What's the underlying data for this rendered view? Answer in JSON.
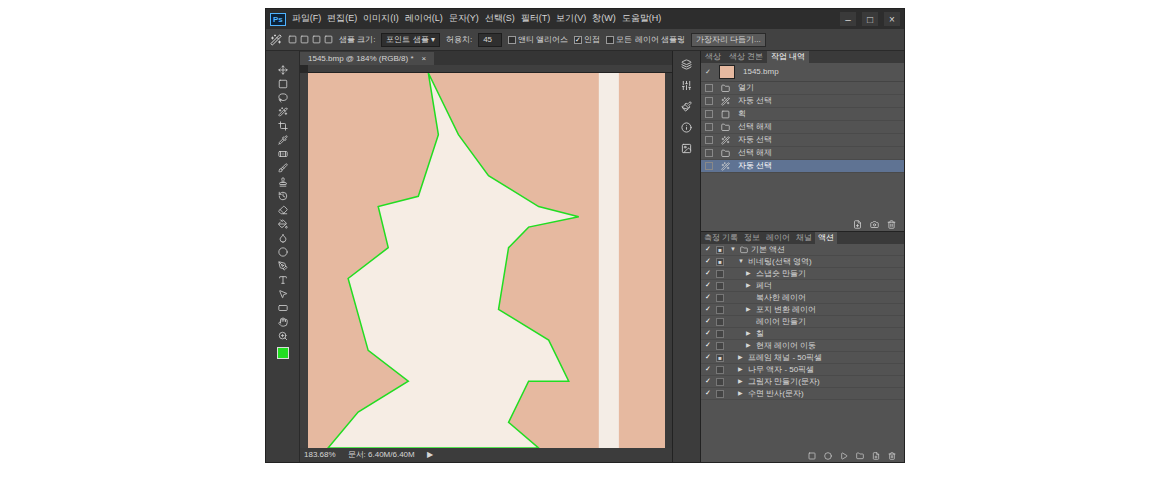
{
  "app": {
    "logo": "Ps",
    "menus": [
      "파일(F)",
      "편집(E)",
      "이미지(I)",
      "레이어(L)",
      "문자(Y)",
      "선택(S)",
      "필터(T)",
      "보기(V)",
      "창(W)",
      "도움말(H)"
    ],
    "window_controls": [
      "–",
      "□",
      "×"
    ]
  },
  "options_bar": {
    "sample_size_label": "샘플 크기:",
    "sample_size_value": "포인트 샘플",
    "tolerance_label": "허용치:",
    "tolerance_value": "45",
    "checks": [
      {
        "label": "앤티 앨리어스",
        "checked": false
      },
      {
        "label": "인접",
        "checked": true
      },
      {
        "label": "모든 레이어 샘플링",
        "checked": false
      }
    ],
    "button": "가장자리 다듬기..."
  },
  "document_tab": {
    "label": "1545.bmp @ 184% (RGB/8) *",
    "close": "×"
  },
  "toolbar": {
    "foreground_color": "#22dd22"
  },
  "status_bar": {
    "zoom": "183.68%",
    "doc": "문서: 6.40M/6.40M",
    "arrow": "▶"
  },
  "history_panel": {
    "tabs": [
      {
        "label": "색상",
        "selected": false
      },
      {
        "label": "색상 견본",
        "selected": false
      },
      {
        "label": "작업 내역",
        "selected": true
      }
    ],
    "snapshot": "1545.bmp",
    "items": [
      {
        "label": "열기",
        "kind": "open",
        "selected": false
      },
      {
        "label": "자동 선택",
        "kind": "wand",
        "selected": false
      },
      {
        "label": "획",
        "kind": "stroke",
        "selected": false
      },
      {
        "label": "선택 해제",
        "kind": "deselect",
        "selected": false
      },
      {
        "label": "자동 선택",
        "kind": "wand",
        "selected": false
      },
      {
        "label": "선택 해제",
        "kind": "deselect",
        "selected": false
      },
      {
        "label": "자동 선택",
        "kind": "wand",
        "selected": true
      }
    ]
  },
  "actions_panel": {
    "tabs": [
      {
        "label": "측정 기록",
        "selected": false
      },
      {
        "label": "정보",
        "selected": false
      },
      {
        "label": "레이어",
        "selected": false
      },
      {
        "label": "채널",
        "selected": false
      },
      {
        "label": "액션",
        "selected": true
      }
    ],
    "items": [
      {
        "label": "기본 액션",
        "depth": 0,
        "kind": "set",
        "expandable": true,
        "expanded": true,
        "checked": true,
        "dialog": true
      },
      {
        "label": "비네팅(선택 영역)",
        "depth": 1,
        "kind": "action",
        "expandable": true,
        "expanded": true,
        "checked": true,
        "dialog": true
      },
      {
        "label": "스냅숏 만들기",
        "depth": 2,
        "kind": "step",
        "expandable": true,
        "expanded": false,
        "checked": true,
        "dialog": false
      },
      {
        "label": "페더",
        "depth": 2,
        "kind": "step",
        "expandable": true,
        "expanded": false,
        "checked": true,
        "dialog": false
      },
      {
        "label": "복사한 레이어",
        "depth": 2,
        "kind": "step",
        "expandable": false,
        "expanded": false,
        "checked": true,
        "dialog": false
      },
      {
        "label": "포지 변환 레이어",
        "depth": 2,
        "kind": "step",
        "expandable": true,
        "expanded": false,
        "checked": true,
        "dialog": false
      },
      {
        "label": "레이어 만들기",
        "depth": 2,
        "kind": "step",
        "expandable": false,
        "expanded": false,
        "checked": true,
        "dialog": false
      },
      {
        "label": "칠",
        "depth": 2,
        "kind": "step",
        "expandable": true,
        "expanded": false,
        "checked": true,
        "dialog": false
      },
      {
        "label": "현재 레이어 이동",
        "depth": 2,
        "kind": "step",
        "expandable": true,
        "expanded": false,
        "checked": true,
        "dialog": false
      },
      {
        "label": "프레임 채널 - 50픽셀",
        "depth": 1,
        "kind": "action",
        "expandable": true,
        "expanded": false,
        "checked": true,
        "dialog": true
      },
      {
        "label": "나무 액자 - 50픽셀",
        "depth": 1,
        "kind": "action",
        "expandable": true,
        "expanded": false,
        "checked": true,
        "dialog": false
      },
      {
        "label": "그림자 만들기(문자)",
        "depth": 1,
        "kind": "action",
        "expandable": true,
        "expanded": false,
        "checked": true,
        "dialog": false
      },
      {
        "label": "수면 반사(문자)",
        "depth": 1,
        "kind": "action",
        "expandable": true,
        "expanded": false,
        "checked": true,
        "dialog": false
      }
    ]
  }
}
